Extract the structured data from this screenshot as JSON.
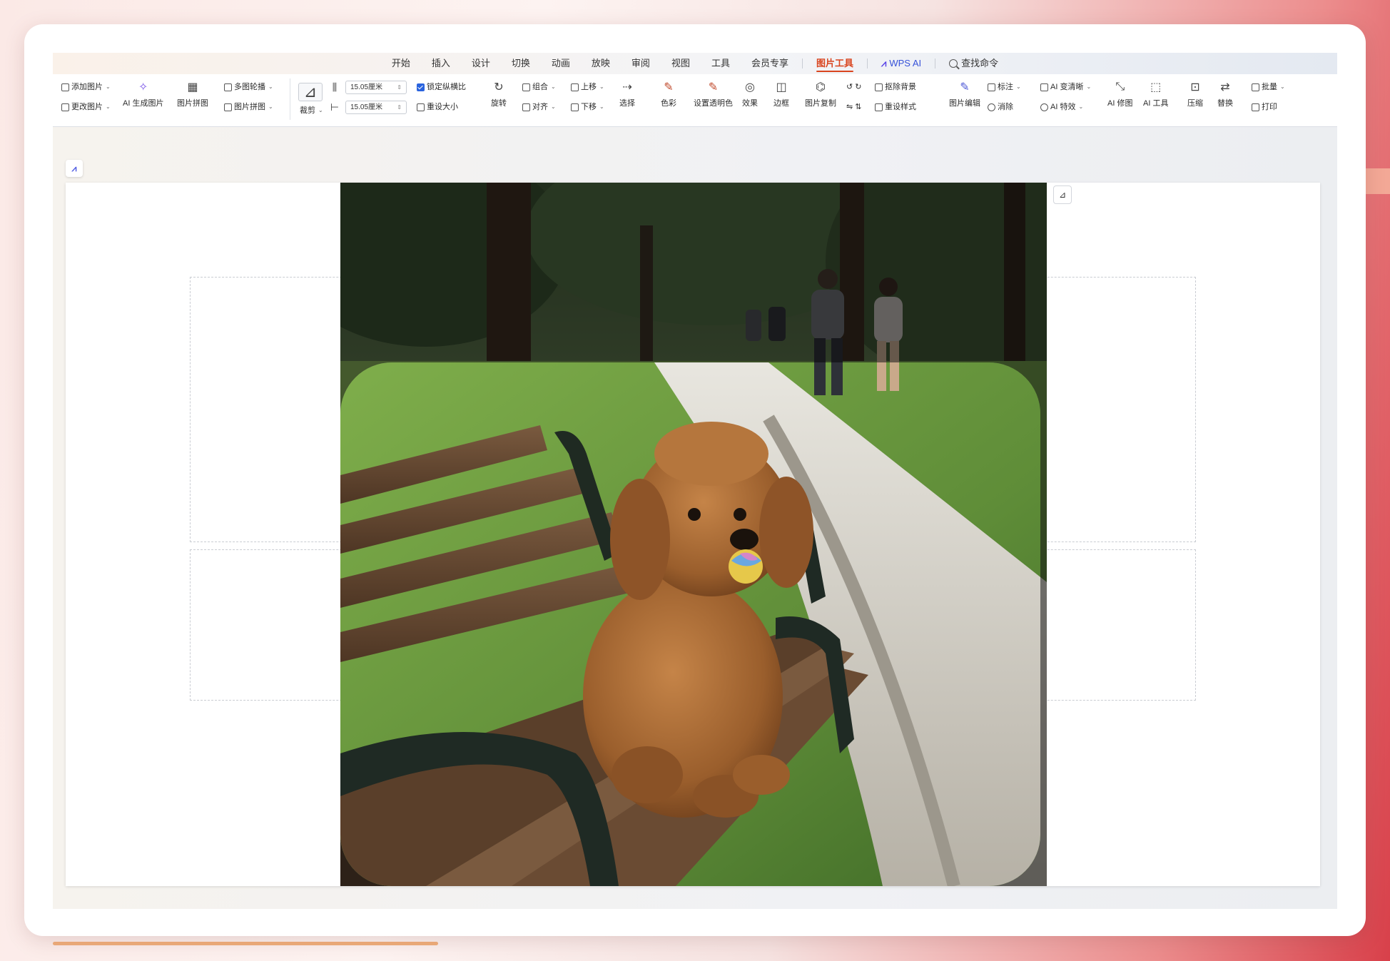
{
  "tabs": [
    "开始",
    "插入",
    "设计",
    "切换",
    "动画",
    "放映",
    "审阅",
    "视图",
    "工具",
    "会员专享",
    "图片工具",
    "WPS AI",
    "查找命令"
  ],
  "active_tab": "图片工具",
  "ribbon": {
    "add_picture": "添加图片",
    "replace_picture": "更改图片",
    "ai_generate_picture": "AI 生成图片",
    "picture_tools_a": "图片拼图",
    "picture_tools_b": "多图轮播",
    "crop": "裁剪",
    "height_value": "15.05厘米",
    "width_value": "15.05厘米",
    "lock_ratio": "锁定纵横比",
    "reset_size": "重设大小",
    "rotate": "旋转",
    "combine": "组合",
    "align": "对齐",
    "move_up": "上移",
    "move_down": "下移",
    "select_pane": "选择",
    "color": "色彩",
    "set_transparent": "设置透明色",
    "effects": "效果",
    "border": "边框",
    "picture_reset": "图片复制",
    "matting": "抠除背景",
    "reset_style": "重设样式",
    "picture_compress": "图片编辑",
    "annotation": "标注",
    "eraser": "消除",
    "ai_enhance": "AI 变清晰",
    "ai_effects": "AI 特效",
    "ai_fix": "AI 修图",
    "ai_tools": "AI 工具",
    "compress": "压缩",
    "replace": "替换",
    "batch": "批量",
    "print": "打印"
  },
  "photo": {
    "description_icon": "poodle-on-bench-photo"
  },
  "colors": {
    "accent_tab": "#d9451f",
    "checkbox": "#2a63de",
    "ai_purple": "#5a44e8"
  }
}
